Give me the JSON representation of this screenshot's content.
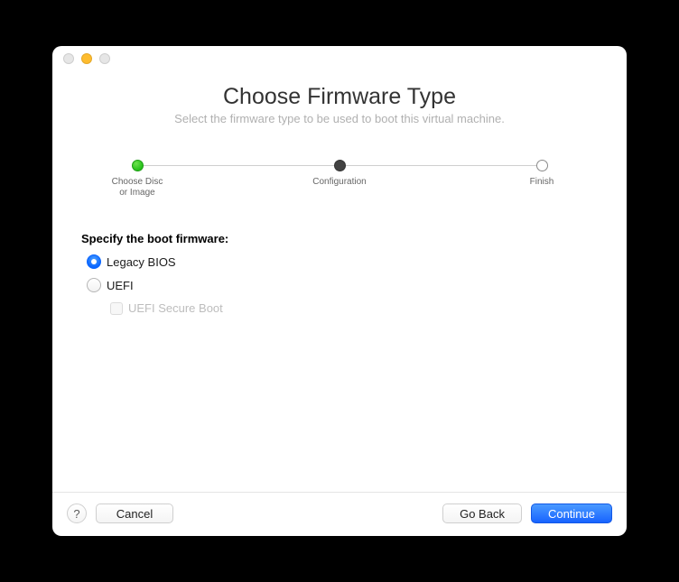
{
  "header": {
    "title": "Choose Firmware Type",
    "subtitle": "Select the firmware type to be used to boot this virtual machine."
  },
  "stepper": {
    "steps": [
      {
        "label": "Choose Disc\nor Image",
        "state": "done"
      },
      {
        "label": "Configuration",
        "state": "active"
      },
      {
        "label": "Finish",
        "state": "pending"
      }
    ]
  },
  "form": {
    "section_label": "Specify the boot firmware:",
    "options": [
      {
        "id": "legacy-bios",
        "label": "Legacy BIOS",
        "checked": true
      },
      {
        "id": "uefi",
        "label": "UEFI",
        "checked": false
      }
    ],
    "secure_boot": {
      "label": "UEFI Secure Boot",
      "checked": false,
      "enabled": false
    }
  },
  "footer": {
    "help": "?",
    "cancel": "Cancel",
    "back": "Go Back",
    "continue": "Continue"
  }
}
